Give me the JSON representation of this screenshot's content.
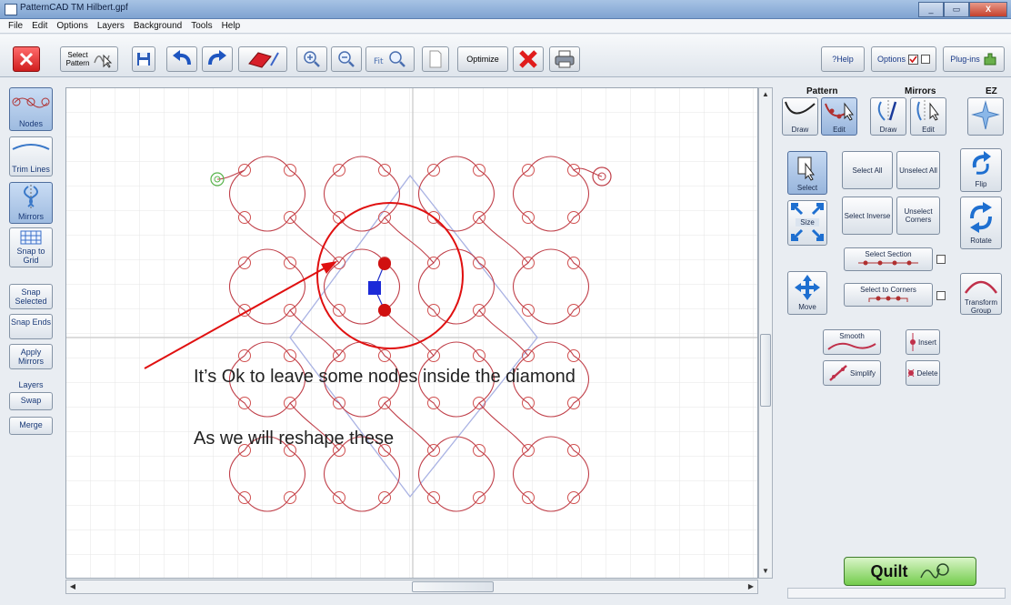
{
  "window": {
    "title": "PatternCAD TM  Hilbert.gpf",
    "buttons": [
      "_",
      "▭",
      "X"
    ]
  },
  "menu": {
    "items": [
      "File",
      "Edit",
      "Options",
      "Layers",
      "Background",
      "Tools",
      "Help"
    ]
  },
  "toolbar": {
    "select_pattern_label": "Select Pattern",
    "optimize_label": "Optimize",
    "help_label": "?Help",
    "options_label": "Options",
    "plugins_label": "Plug-ins"
  },
  "left_panel": {
    "nodes": "Nodes",
    "trim_lines": "Trim Lines",
    "mirrors": "Mirrors",
    "snap_to_grid": "Snap to Grid",
    "snap_selected": "Snap Selected",
    "snap_ends": "Snap Ends",
    "apply_mirrors": "Apply Mirrors",
    "layers": "Layers",
    "swap": "Swap",
    "merge": "Merge"
  },
  "right_panel": {
    "pattern_title": "Pattern",
    "mirrors_title": "Mirrors",
    "ez_title": "EZ",
    "draw": "Draw",
    "edit": "Edit",
    "mirror_draw": "Draw",
    "mirror_edit": "Edit",
    "select": "Select",
    "select_all": "Select All",
    "unselect_all": "Unselect All",
    "flip": "Flip",
    "size": "Size",
    "select_inverse": "Select Inverse",
    "unselect_corners": "Unselect Corners",
    "rotate": "Rotate",
    "select_section": "Select Section",
    "move": "Move",
    "select_to_corners": "Select to Corners",
    "transform_group": "Transform Group",
    "smooth": "Smooth",
    "insert": "Insert",
    "simplify": "Simplify",
    "delete": "Delete",
    "quilt": "Quilt"
  },
  "annotation": {
    "line1": "It’s Ok to leave some nodes inside the diamond",
    "line2": "As we will reshape these"
  },
  "colors": {
    "pattern": "#c0404a",
    "node_circle": "#d05050",
    "selected_node": "#d01010",
    "center_node": "#1c2ad8",
    "annotation": "#e01010",
    "diamond": "#9ea8e0",
    "grid": "#dcdcdc",
    "quilt_button": "#73cc4c"
  }
}
